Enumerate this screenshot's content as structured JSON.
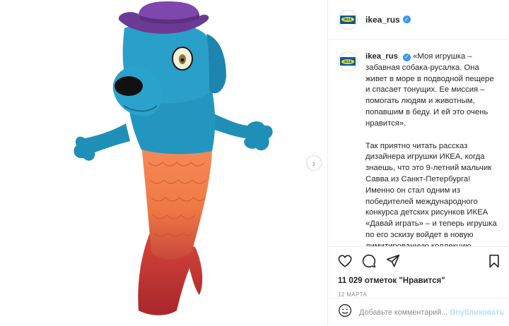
{
  "post": {
    "username": "ikea_rus",
    "logo_text": "IKEA",
    "verified": true,
    "media_alt": "plush toy dog-mermaid",
    "next_icon": "chevron-right-icon"
  },
  "caption": {
    "username": "ikea_rus",
    "text_1": "«Моя игрушка – забавная собака-русалка. Она живет в море в подводной пещере и спасает тонущих. Ее миссия – помогать людям и животным, попавшим в беду. И ей это очень нравится».",
    "text_2": "Так приятно читать рассказ дизайнера игрушки ИКЕА, когда знаешь, что это 9-летний мальчик Савва из Санкт-Петербурга! Именно он стал одним из победителей международного конкурса детских рисунков ИКЕА «Давай играть» – и теперь игрушка по его эскизу войдет в новую лимитированную коллекцию плюшевых персонажей SAGOSKATT/САГОСКАТТ и будет продаваться в магазинах ИКЕА по всему миру."
  },
  "actions": {
    "icons": [
      "heart-icon",
      "comment-icon",
      "share-icon",
      "bookmark-icon"
    ],
    "likes": "11 029 отметок \"Нравится\"",
    "date": "12 МАРТА"
  },
  "comment": {
    "placeholder": "Добавьте комментарий...",
    "publish_label": "Опубликовать",
    "emoji_icon": "smiley-icon"
  },
  "colors": {
    "accent_blue": "#3897f0",
    "publish_disabled": "#b2dffc",
    "secondary_text": "#8e8e8e",
    "ikea_blue": "#0058a3",
    "ikea_yellow": "#ffdb00"
  }
}
